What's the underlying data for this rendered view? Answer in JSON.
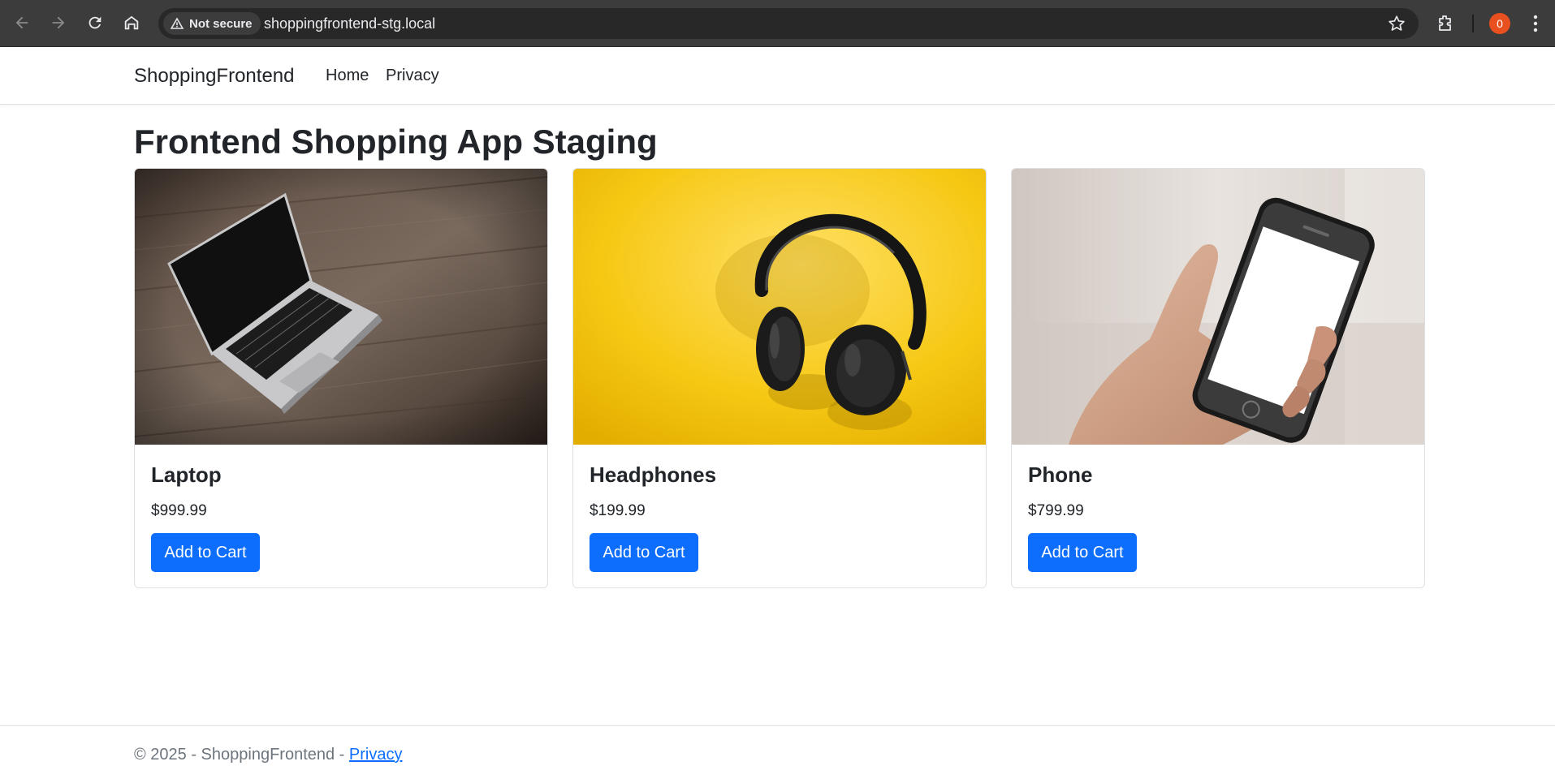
{
  "browser": {
    "security_label": "Not secure",
    "url": "shoppingfrontend-stg.local",
    "profile_badge": "0",
    "accent_color": "#e8501f"
  },
  "navbar": {
    "brand": "ShoppingFrontend",
    "links": [
      {
        "label": "Home"
      },
      {
        "label": "Privacy"
      }
    ]
  },
  "main": {
    "title": "Frontend Shopping App Staging",
    "products": [
      {
        "name": "Laptop",
        "price": "$999.99",
        "button": "Add to Cart",
        "image": "laptop-photo"
      },
      {
        "name": "Headphones",
        "price": "$199.99",
        "button": "Add to Cart",
        "image": "headphones-photo"
      },
      {
        "name": "Phone",
        "price": "$799.99",
        "button": "Add to Cart",
        "image": "phone-photo"
      }
    ],
    "button_color": "#0d6efd"
  },
  "footer": {
    "text": "© 2025 - ShoppingFrontend - ",
    "link": "Privacy"
  }
}
